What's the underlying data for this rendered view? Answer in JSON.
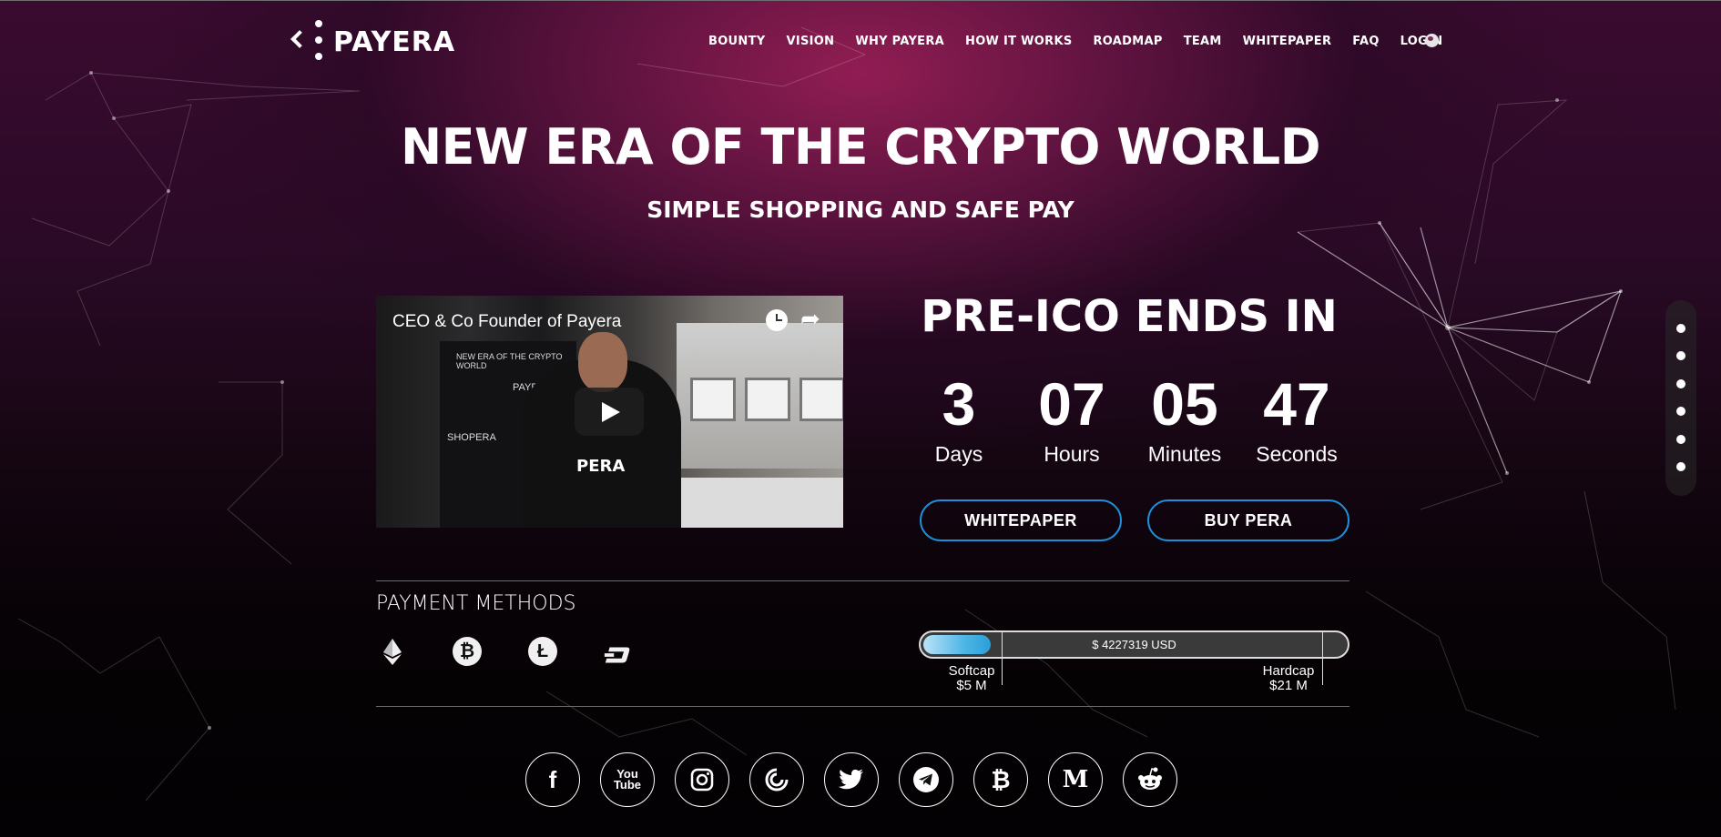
{
  "brand": {
    "logo_text": "PAYERA"
  },
  "nav": {
    "items": [
      "BOUNTY",
      "VISION",
      "WHY PAYERA",
      "HOW IT WORKS",
      "ROADMAP",
      "TEAM",
      "WHITEPAPER",
      "FAQ",
      "LOGIN"
    ]
  },
  "hero": {
    "title": "NEW ERA OF THE CRYPTO WORLD",
    "subtitle": "SIMPLE SHOPPING AND SAFE PAY"
  },
  "video": {
    "title": "CEO & Co Founder of Payera",
    "banner_text": [
      "NEW ERA OF THE CRYPTO WORLD",
      "PAYERA",
      "SHOPERA"
    ],
    "shirt_logo": "PERA"
  },
  "countdown": {
    "title": "PRE-ICO ENDS IN",
    "days": "3",
    "days_label": "Days",
    "hours": "07",
    "hours_label": "Hours",
    "minutes": "05",
    "minutes_label": "Minutes",
    "seconds": "47",
    "seconds_label": "Seconds"
  },
  "buttons": {
    "whitepaper": "WHITEPAPER",
    "buy": "BUY PERA"
  },
  "payment": {
    "title": "PAYMENT METHODS",
    "methods": [
      "ethereum-icon",
      "bitcoin-icon",
      "litecoin-icon",
      "dash-icon"
    ]
  },
  "progress": {
    "raised_label": "$ 4227319 USD",
    "raised_usd": 4227319,
    "softcap_label": "Softcap",
    "softcap_value": "$5 M",
    "hardcap_label": "Hardcap",
    "hardcap_value": "$21 M"
  },
  "social": [
    "facebook-icon",
    "youtube-icon",
    "instagram-icon",
    "bitcointalk-icon",
    "twitter-icon",
    "telegram-icon",
    "bitcoin-icon",
    "medium-icon",
    "reddit-icon"
  ],
  "colors": {
    "accent": "#1e8fd8",
    "progress": "#4fb6e6",
    "hero_glow": "#961e55"
  }
}
